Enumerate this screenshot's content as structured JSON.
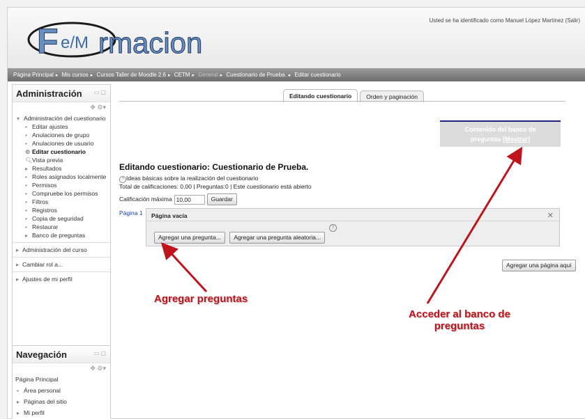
{
  "header": {
    "logo_text": "F e/M rmacion",
    "login_info": "Usted se ha identificado como Manuel López Martínez (Salir)"
  },
  "breadcrumb": [
    {
      "label": "Página Principal"
    },
    {
      "label": "Mis cursos"
    },
    {
      "label": "Cursos Taller de Moodle 2.6"
    },
    {
      "label": "CETM"
    },
    {
      "label": "General"
    },
    {
      "label": "Cuestionario de Prueba."
    },
    {
      "label": "Editar cuestionario"
    }
  ],
  "admin": {
    "title": "Administración",
    "root_label": "Administración del cuestionario",
    "items": [
      {
        "label": "Editar ajustes"
      },
      {
        "label": "Anulaciones de grupo"
      },
      {
        "label": "Anulaciones de usuario"
      },
      {
        "label": "Editar cuestionario"
      },
      {
        "label": "Vista previa"
      },
      {
        "label": "Resultados"
      },
      {
        "label": "Roles asignados localmente"
      },
      {
        "label": "Permisos"
      },
      {
        "label": "Compruebe los permisos"
      },
      {
        "label": "Filtros"
      },
      {
        "label": "Registros"
      },
      {
        "label": "Copia de seguridad"
      },
      {
        "label": "Restaurar"
      },
      {
        "label": "Banco de preguntas"
      }
    ],
    "links": [
      {
        "label": "Administración del curso"
      },
      {
        "label": "Cambiar rol a..."
      },
      {
        "label": "Ajustes de mi perfil"
      }
    ]
  },
  "navigation": {
    "title": "Navegación",
    "items": [
      {
        "label": "Página Principal"
      },
      {
        "label": "Área personal"
      },
      {
        "label": "Páginas del sitio"
      },
      {
        "label": "Mi perfil"
      }
    ]
  },
  "tabs": [
    {
      "label": "Editando cuestionario",
      "active": true
    },
    {
      "label": "Orden y paginación",
      "active": false
    }
  ],
  "question_bank": {
    "text": "Contenido del banco de",
    "text2": "preguntas",
    "link": "[Mostrar]"
  },
  "main": {
    "title": "Editando cuestionario: Cuestionario de Prueba.",
    "ideas_link": "Ideas básicas sobre la realización del cuestionario",
    "totals": "Total de calificaciones: 0,00 | Preguntas:0 | Este cuestionario está abierto",
    "max_grade_label": "Calificación máxima",
    "max_grade_value": "10,00",
    "save_button": "Guardar",
    "page_label": "Página 1",
    "empty_page_title": "Página vacía",
    "add_question_button": "Agregar una pregunta...",
    "add_random_button": "Agregar una pregunta aleatoria...",
    "add_page_button": "Agregar una página aquí"
  },
  "annotations": {
    "add_questions": "Agregar preguntas",
    "access_bank_line1": "Acceder al banco de",
    "access_bank_line2": "preguntas"
  },
  "colors": {
    "annotation": "#c0141c",
    "nav_bar": "#7a7a7a",
    "link": "#1a3aa0"
  }
}
